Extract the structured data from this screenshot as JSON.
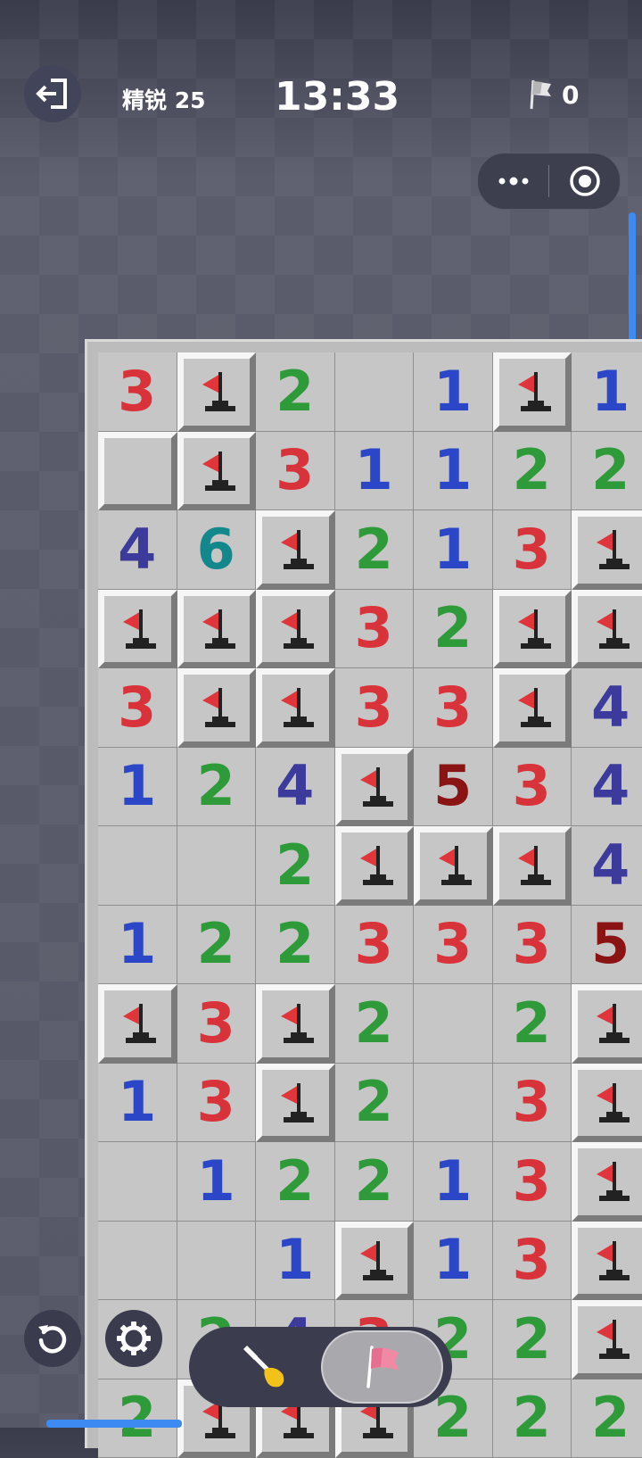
{
  "header": {
    "exit_icon": "exit-icon",
    "level_label": "精锐 25",
    "timer": "13:33",
    "flag_icon": "flag-icon",
    "flag_count": "0"
  },
  "capsule": {
    "more_icon": "more-dots-icon",
    "target_icon": "target-icon"
  },
  "board": {
    "columns": 7,
    "rows": [
      [
        "3",
        "F",
        "2",
        "",
        "1",
        "F",
        "1"
      ],
      [
        "C",
        "F",
        "3",
        "1",
        "1",
        "2",
        "2"
      ],
      [
        "4",
        "6",
        "F",
        "2",
        "1",
        "3",
        "F"
      ],
      [
        "F",
        "F",
        "F",
        "3",
        "2",
        "F",
        "F"
      ],
      [
        "3",
        "F",
        "F",
        "3",
        "3",
        "F",
        "4"
      ],
      [
        "1",
        "2",
        "4",
        "F",
        "5",
        "3",
        "4"
      ],
      [
        "",
        "",
        "2",
        "F",
        "F",
        "F",
        "4"
      ],
      [
        "1",
        "2",
        "2",
        "3",
        "3",
        "3",
        "5"
      ],
      [
        "F",
        "3",
        "F",
        "2",
        "",
        "2",
        "F"
      ],
      [
        "1",
        "3",
        "F",
        "2",
        "",
        "3",
        "F"
      ],
      [
        "",
        "1",
        "2",
        "2",
        "1",
        "3",
        "F"
      ],
      [
        "",
        "",
        "1",
        "F",
        "1",
        "3",
        "F"
      ],
      [
        "1",
        "2",
        "4",
        "3",
        "2",
        "2",
        "F"
      ],
      [
        "2",
        "F",
        "F",
        "F",
        "2",
        "2",
        "2"
      ]
    ]
  },
  "controls": {
    "undo_icon": "undo-icon",
    "settings_icon": "gear-icon",
    "dig_icon": "shovel-icon",
    "flag_mode_icon": "pink-flag-icon"
  },
  "colors": {
    "n1": "#2c46c8",
    "n2": "#2f9a3a",
    "n3": "#d8333a",
    "n4": "#3c3b9c",
    "n5": "#8a1414",
    "n6": "#12878c",
    "accent": "#3d8bf2"
  }
}
